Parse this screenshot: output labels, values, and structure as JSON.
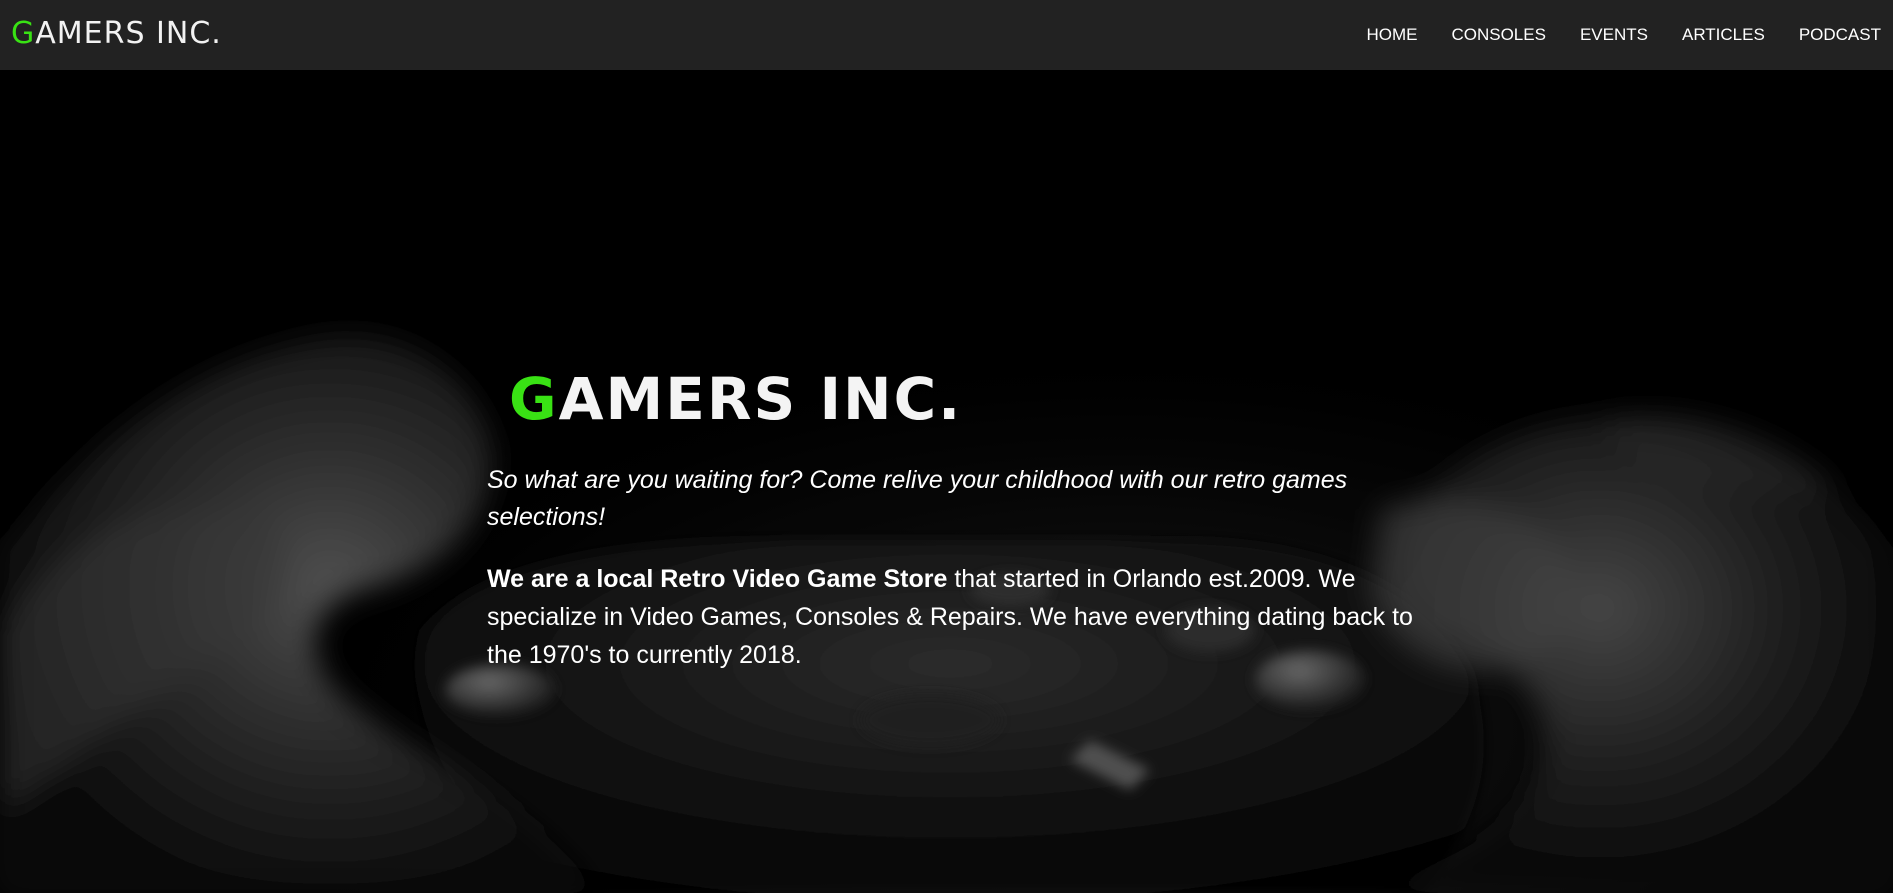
{
  "brand": {
    "initial": "G",
    "rest": "AMERS INC."
  },
  "nav": {
    "items": [
      {
        "label": "HOME"
      },
      {
        "label": "CONSOLES"
      },
      {
        "label": "EVENTS"
      },
      {
        "label": "ARTICLES"
      },
      {
        "label": "PODCAST"
      }
    ]
  },
  "hero": {
    "title_initial": "G",
    "title_rest": "AMERS INC.",
    "tagline": "So what are you waiting for? Come relive your childhood with our retro games selections!",
    "about_bold": "We are a local Retro Video Game Store",
    "about_rest": " that started in Orlando est.2009. We specialize in Video Games, Consoles & Repairs. We have everything dating back to the 1970's to currently 2018.",
    "background_image": "hands-holding-game-controller"
  },
  "colors": {
    "accent": "#39e214",
    "navbar_bg": "#222222",
    "hero_bg": "#000000",
    "text": "#ffffff"
  }
}
